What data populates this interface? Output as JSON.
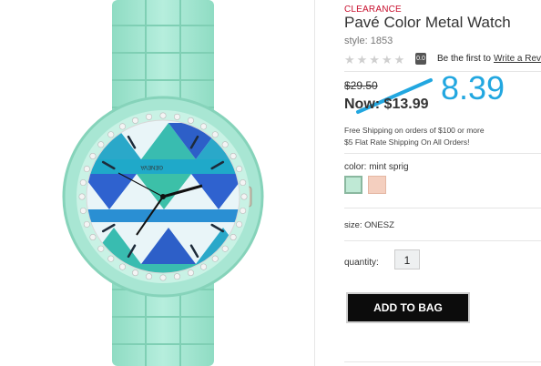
{
  "product": {
    "badge": "CLEARANCE",
    "title": "Pavé Color Metal Watch",
    "style": "style: 1853"
  },
  "rating": {
    "stars": "★★★★★",
    "score": "0.0",
    "first_text": "Be the first to",
    "review_link": "Write a Revi"
  },
  "price": {
    "original": "$29.50",
    "now": "Now: $13.99",
    "annotation": "8.39"
  },
  "shipping": {
    "line1": "Free Shipping on orders of $100 or more",
    "line2": "$5 Flat Rate Shipping On All Orders!"
  },
  "color": {
    "label": "color: mint sprig",
    "swatches": [
      "mint sprig",
      "peach"
    ],
    "swatch_colors": [
      "#bfe9d5",
      "#f4cfbf"
    ]
  },
  "size": {
    "label": "size: ONESZ"
  },
  "quantity": {
    "label": "quantity:",
    "value": "1"
  },
  "cart": {
    "button": "ADD TO BAG"
  },
  "watch": {
    "brand": "GENEVA"
  },
  "colors": {
    "clearance": "#c8102e",
    "annotation": "#22a7e0",
    "button": "#0c0c0c",
    "watch_band": "#a8e6d3"
  }
}
